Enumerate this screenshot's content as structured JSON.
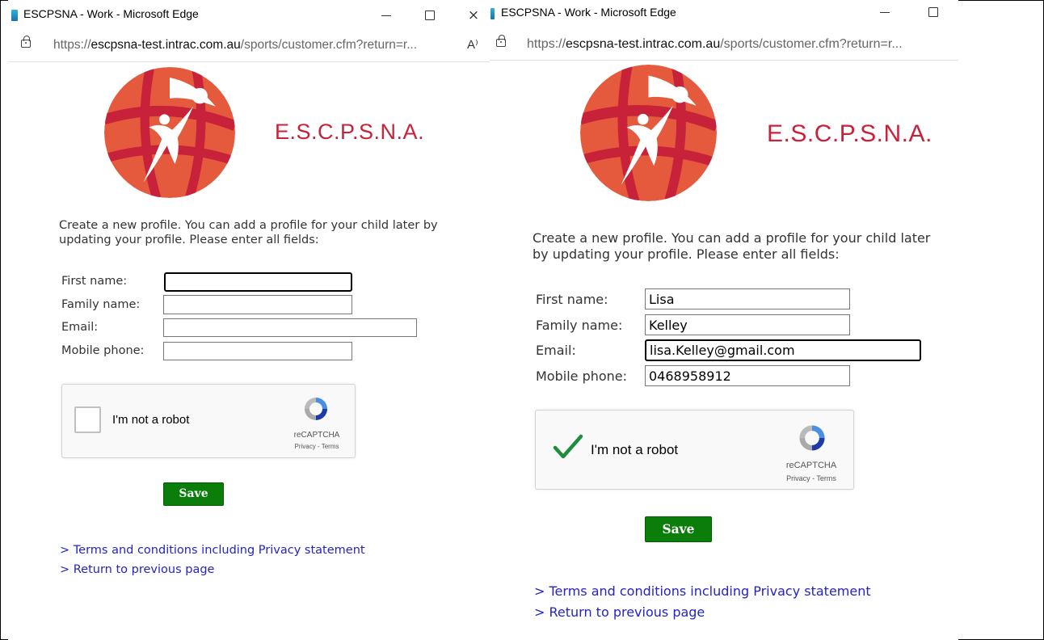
{
  "window_left": {
    "title": "ESCPSNA - Work - Microsoft Edge",
    "close_glyph": "×",
    "url_prefix": "https://",
    "url_domain": "escpsna-test.intrac.com.au",
    "url_path": "/sports/customer.cfm?return=r...",
    "read_aloud_glyph": "A⁾",
    "org_name": "E.S.C.P.S.N.A.",
    "intro_text": "Create a new profile. You can add a profile for your child later by updating your profile. Please enter all fields:",
    "labels": {
      "first_name": "First name:",
      "family_name": "Family name:",
      "email": "Email:",
      "mobile": "Mobile phone:"
    },
    "values": {
      "first_name": "",
      "family_name": "",
      "email": "",
      "mobile": ""
    },
    "captcha": {
      "checked": false,
      "label": "I'm not a robot",
      "brand": "reCAPTCHA",
      "links": "Privacy - Terms"
    },
    "save_label": "Save",
    "links": {
      "terms": "> Terms and conditions including Privacy statement",
      "return": "> Return to previous page"
    }
  },
  "window_right": {
    "title": "ESCPSNA - Work - Microsoft Edge",
    "url_prefix": "https://",
    "url_domain": "escpsna-test.intrac.com.au",
    "url_path": "/sports/customer.cfm?return=r...",
    "org_name": "E.S.C.P.S.N.A.",
    "intro_text": "Create a new profile. You can add a profile for your child later by updating your profile. Please enter all fields:",
    "labels": {
      "first_name": "First name:",
      "family_name": "Family name:",
      "email": "Email:",
      "mobile": "Mobile phone:"
    },
    "values": {
      "first_name": "Lisa",
      "family_name": "Kelley",
      "email": "lisa.Kelley@gmail.com",
      "mobile": "0468958912"
    },
    "captcha": {
      "checked": true,
      "label": "I'm not a robot",
      "brand": "reCAPTCHA",
      "links": "Privacy - Terms"
    },
    "save_label": "Save",
    "links": {
      "terms": "> Terms and conditions including Privacy statement",
      "return": "> Return to previous page"
    }
  },
  "colors": {
    "brand_red": "#c8223a",
    "save_green": "#0a7d0a",
    "link_blue": "#2323c8",
    "check_green": "#1e8e3e"
  },
  "icons": [
    "edge-app-icon",
    "minimize-icon",
    "maximize-icon",
    "close-icon",
    "lock-icon",
    "read-aloud-icon",
    "recaptcha-logo-icon",
    "checkmark-icon",
    "netball-logo"
  ]
}
